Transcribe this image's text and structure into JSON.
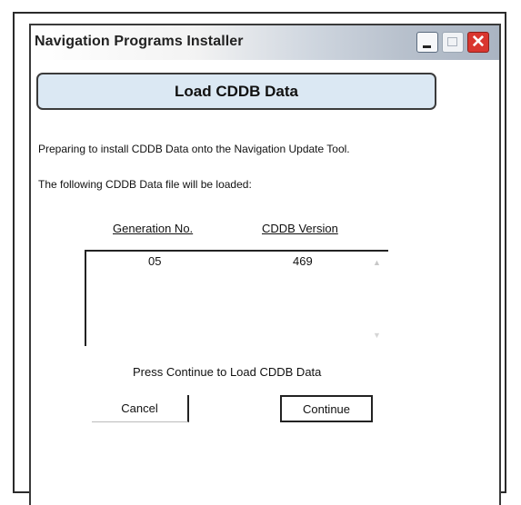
{
  "window": {
    "title": "Navigation Programs Installer",
    "close_symbol": "✕"
  },
  "dialog": {
    "header": "Load CDDB Data",
    "line1": "Preparing to install CDDB Data onto the Navigation Update Tool.",
    "line2": "The following CDDB Data file will be loaded:",
    "table": {
      "columns": [
        "Generation No.",
        "CDDB Version"
      ],
      "rows": [
        [
          "05",
          "469"
        ]
      ]
    },
    "instruction": "Press Continue to Load CDDB Data",
    "buttons": {
      "cancel": "Cancel",
      "continue": "Continue"
    }
  },
  "colors": {
    "header_bg": "#dbe8f3",
    "close_button": "#d9362f"
  },
  "icons": [
    "minimize-icon",
    "maximize-icon",
    "close-icon",
    "scroll-up-icon",
    "scroll-down-icon"
  ]
}
